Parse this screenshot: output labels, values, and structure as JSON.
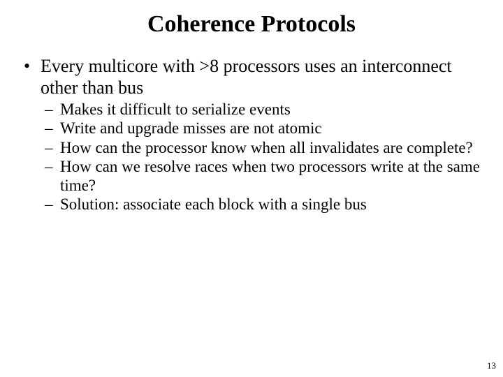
{
  "title": "Coherence Protocols",
  "main_bullet": "Every multicore with >8 processors uses an interconnect other than bus",
  "sub": [
    "Makes it difficult to serialize events",
    "Write and upgrade misses are not atomic",
    "How can the processor know when all invalidates are complete?",
    "How can we resolve races when two processors write at the same time?",
    "Solution:  associate each block with a single bus"
  ],
  "page_number": "13"
}
